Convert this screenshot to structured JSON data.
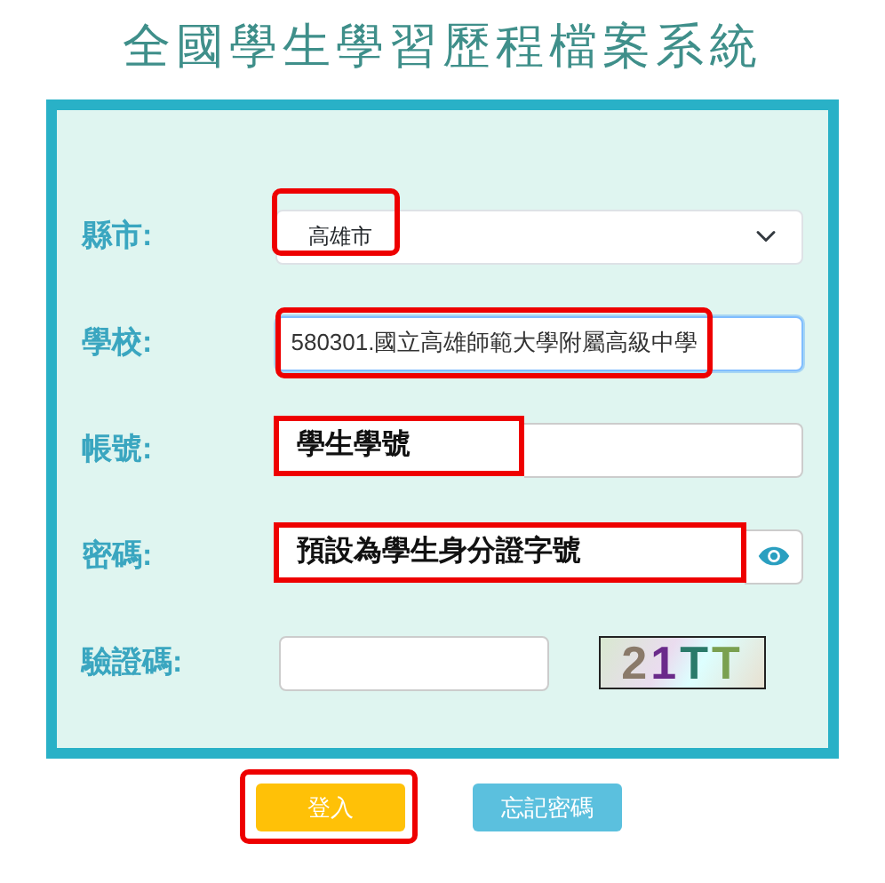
{
  "title": "全國學生學習歷程檔案系統",
  "fields": [
    {
      "label": "縣市:",
      "kind": "select",
      "value": "高雄市",
      "highlighted": true
    },
    {
      "label": "學校:",
      "kind": "text",
      "value": "580301.國立高雄師範大學附屬高級中學",
      "focused": true,
      "highlighted": true
    },
    {
      "label": "帳號:",
      "kind": "text",
      "annotation": "學生學號"
    },
    {
      "label": "密碼:",
      "kind": "password",
      "annotation": "預設為學生身分證字號"
    },
    {
      "label": "驗證碼:",
      "kind": "captcha",
      "captcha": "21TT"
    }
  ],
  "buttons": [
    {
      "label": "登入",
      "kind": "primary",
      "highlighted": true
    },
    {
      "label": "忘記密碼",
      "kind": "secondary",
      "highlighted": false
    }
  ]
}
